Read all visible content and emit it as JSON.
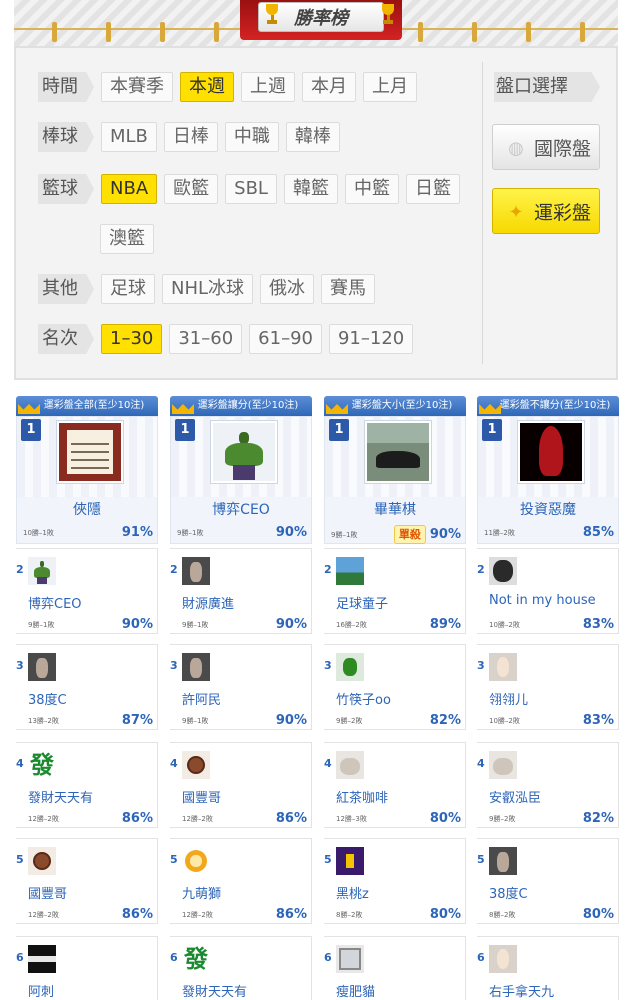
{
  "banner": {
    "title": "勝率榜"
  },
  "filters": {
    "rows": [
      {
        "label": "時間",
        "options": [
          {
            "text": "本賽季",
            "active": false
          },
          {
            "text": "本週",
            "active": true
          },
          {
            "text": "上週",
            "active": false
          },
          {
            "text": "本月",
            "active": false
          },
          {
            "text": "上月",
            "active": false
          }
        ]
      },
      {
        "label": "棒球",
        "options": [
          {
            "text": "MLB",
            "active": false
          },
          {
            "text": "日棒",
            "active": false
          },
          {
            "text": "中職",
            "active": false
          },
          {
            "text": "韓棒",
            "active": false
          }
        ]
      },
      {
        "label": "籃球",
        "options": [
          {
            "text": "NBA",
            "active": true
          },
          {
            "text": "歐籃",
            "active": false
          },
          {
            "text": "SBL",
            "active": false
          },
          {
            "text": "韓籃",
            "active": false
          },
          {
            "text": "中籃",
            "active": false
          },
          {
            "text": "日籃",
            "active": false
          }
        ]
      },
      {
        "label": "",
        "options": [
          {
            "text": "澳籃",
            "active": false
          }
        ]
      },
      {
        "label": "其他",
        "options": [
          {
            "text": "足球",
            "active": false
          },
          {
            "text": "NHL冰球",
            "active": false
          },
          {
            "text": "俄冰",
            "active": false
          },
          {
            "text": "賽馬",
            "active": false
          }
        ]
      },
      {
        "label": "名次",
        "options": [
          {
            "text": "1–30",
            "active": true
          },
          {
            "text": "31–60",
            "active": false
          },
          {
            "text": "61–90",
            "active": false
          },
          {
            "text": "91–120",
            "active": false
          }
        ]
      }
    ],
    "market": {
      "label": "盤口選擇",
      "international": "國際盤",
      "lottery": "運彩盤",
      "selected": "運彩盤"
    }
  },
  "boards": [
    {
      "header": "運彩盤全部(至少10注)",
      "entries": [
        {
          "rank": "1",
          "name": "俠隱",
          "record": "10勝–1敗",
          "pct": "91%",
          "avatar": "calligraphy"
        },
        {
          "rank": "2",
          "name": "博弈CEO",
          "record": "9勝–1敗",
          "pct": "90%",
          "avatar": "hulk"
        },
        {
          "rank": "3",
          "name": "38度C",
          "record": "13勝–2敗",
          "pct": "87%",
          "avatar": "photo"
        },
        {
          "rank": "4",
          "name": "發財天天有",
          "record": "12勝–2敗",
          "pct": "86%",
          "avatar": "fa"
        },
        {
          "rank": "5",
          "name": "國豐哥",
          "record": "12勝–2敗",
          "pct": "86%",
          "avatar": "medal"
        },
        {
          "rank": "6",
          "name": "阿刺",
          "record": "",
          "pct": "",
          "avatar": "book"
        }
      ]
    },
    {
      "header": "運彩盤讓分(至少10注)",
      "entries": [
        {
          "rank": "1",
          "name": "博弈CEO",
          "record": "9勝–1敗",
          "pct": "90%",
          "avatar": "hulk"
        },
        {
          "rank": "2",
          "name": "財源廣進",
          "record": "9勝–1敗",
          "pct": "90%",
          "avatar": "photo"
        },
        {
          "rank": "3",
          "name": "許阿民",
          "record": "9勝–1敗",
          "pct": "90%",
          "avatar": "photo"
        },
        {
          "rank": "4",
          "name": "國豐哥",
          "record": "12勝–2敗",
          "pct": "86%",
          "avatar": "medal"
        },
        {
          "rank": "5",
          "name": "九萌獅",
          "record": "12勝–2敗",
          "pct": "86%",
          "avatar": "lion"
        },
        {
          "rank": "6",
          "name": "發財天天有",
          "record": "",
          "pct": "",
          "avatar": "fa"
        }
      ]
    },
    {
      "header": "運彩盤大小(至少10注)",
      "entries": [
        {
          "rank": "1",
          "name": "畢華棋",
          "record": "9勝–1敗",
          "pct": "90%",
          "avatar": "car",
          "badge": "單殺"
        },
        {
          "rank": "2",
          "name": "足球童子",
          "record": "16勝–2敗",
          "pct": "89%",
          "avatar": "sky"
        },
        {
          "rank": "3",
          "name": "竹筷子oo",
          "record": "9勝–2敗",
          "pct": "82%",
          "avatar": "green"
        },
        {
          "rank": "4",
          "name": "紅茶咖啡",
          "record": "12勝–3敗",
          "pct": "80%",
          "avatar": "cat"
        },
        {
          "rank": "5",
          "name": "黑桃z",
          "record": "8勝–2敗",
          "pct": "80%",
          "avatar": "purple"
        },
        {
          "rank": "6",
          "name": "瘦肥貓",
          "record": "",
          "pct": "",
          "avatar": "frame"
        }
      ]
    },
    {
      "header": "運彩盤不讓分(至少10注)",
      "entries": [
        {
          "rank": "1",
          "name": "投資惡魔",
          "record": "11勝–2敗",
          "pct": "85%",
          "avatar": "dark"
        },
        {
          "rank": "2",
          "name": "Not in my house",
          "record": "10勝–2敗",
          "pct": "83%",
          "avatar": "gorilla"
        },
        {
          "rank": "3",
          "name": "翎翎儿",
          "record": "10勝–2敗",
          "pct": "83%",
          "avatar": "face"
        },
        {
          "rank": "4",
          "name": "安叡泓臣",
          "record": "9勝–2敗",
          "pct": "82%",
          "avatar": "cat"
        },
        {
          "rank": "5",
          "name": "38度C",
          "record": "8勝–2敗",
          "pct": "80%",
          "avatar": "photo"
        },
        {
          "rank": "6",
          "name": "右手拿天九",
          "record": "",
          "pct": "",
          "avatar": "face"
        }
      ]
    }
  ]
}
